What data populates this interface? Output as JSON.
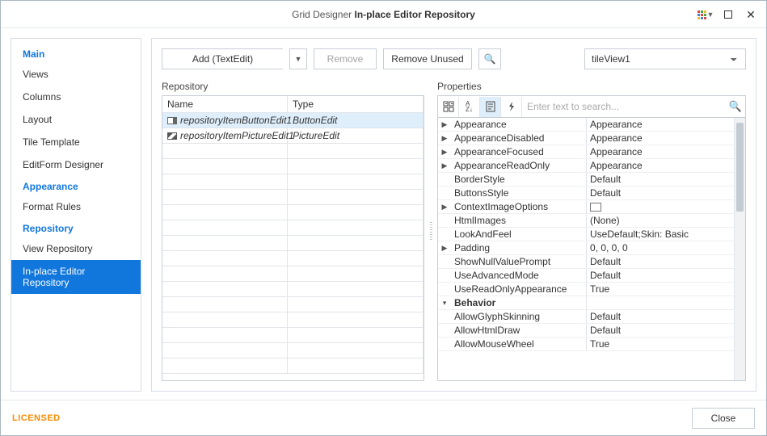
{
  "title": {
    "prefix": "Grid Designer ",
    "main": "In-place Editor Repository"
  },
  "sidebar": {
    "sections": [
      {
        "label": "Main",
        "items": [
          "Views",
          "Columns",
          "Layout",
          "Tile Template",
          "EditForm Designer"
        ]
      },
      {
        "label": "Appearance",
        "items": [
          "Format Rules"
        ]
      },
      {
        "label": "Repository",
        "items": [
          "View Repository",
          "In-place Editor Repository"
        ]
      }
    ],
    "selected": "In-place Editor Repository"
  },
  "toolbar": {
    "add_label": "Add (TextEdit)",
    "remove_label": "Remove",
    "remove_unused_label": "Remove Unused",
    "view_selected": "tileView1"
  },
  "repository": {
    "title": "Repository",
    "columns": {
      "name": "Name",
      "type": "Type"
    },
    "rows": [
      {
        "name": "repositoryItemButtonEdit1",
        "type": "ButtonEdit",
        "icon": "button-edit-icon",
        "selected": true
      },
      {
        "name": "repositoryItemPictureEdit1",
        "type": "PictureEdit",
        "icon": "picture-edit-icon",
        "selected": false
      }
    ],
    "empty_rows": 15
  },
  "properties": {
    "title": "Properties",
    "search_placeholder": "Enter text to search...",
    "rows": [
      {
        "expander": "▶",
        "key": "Appearance",
        "val": "Appearance"
      },
      {
        "expander": "▶",
        "key": "AppearanceDisabled",
        "val": "Appearance"
      },
      {
        "expander": "▶",
        "key": "AppearanceFocused",
        "val": "Appearance"
      },
      {
        "expander": "▶",
        "key": "AppearanceReadOnly",
        "val": "Appearance"
      },
      {
        "expander": "",
        "key": "BorderStyle",
        "val": "Default"
      },
      {
        "expander": "",
        "key": "ButtonsStyle",
        "val": "Default"
      },
      {
        "expander": "▶",
        "key": "ContextImageOptions",
        "val": "__swatch__"
      },
      {
        "expander": "",
        "key": "HtmlImages",
        "val": "(None)"
      },
      {
        "expander": "",
        "key": "LookAndFeel",
        "val": "UseDefault;Skin: Basic"
      },
      {
        "expander": "▶",
        "key": "Padding",
        "val": "0, 0, 0, 0"
      },
      {
        "expander": "",
        "key": "ShowNullValuePrompt",
        "val": "Default"
      },
      {
        "expander": "",
        "key": "UseAdvancedMode",
        "val": "Default"
      },
      {
        "expander": "",
        "key": "UseReadOnlyAppearance",
        "val": "True"
      },
      {
        "expander": "▾",
        "key": "Behavior",
        "val": "",
        "cat": true
      },
      {
        "expander": "",
        "key": "AllowGlyphSkinning",
        "val": "Default"
      },
      {
        "expander": "",
        "key": "AllowHtmlDraw",
        "val": "Default"
      },
      {
        "expander": "",
        "key": "AllowMouseWheel",
        "val": "True"
      }
    ]
  },
  "footer": {
    "licensed": "LICENSED",
    "close": "Close"
  }
}
